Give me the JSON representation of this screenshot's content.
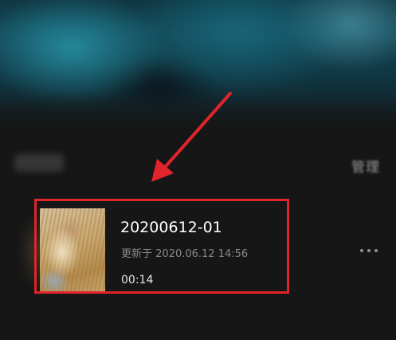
{
  "header": {
    "manage_label": "管理"
  },
  "recording": {
    "title": "20200612-01",
    "updated": "更新于 2020.06.12 14:56",
    "duration": "00:14",
    "more_icon": "more-horizontal-icon"
  },
  "annotation": {
    "color": "#e0242c"
  }
}
